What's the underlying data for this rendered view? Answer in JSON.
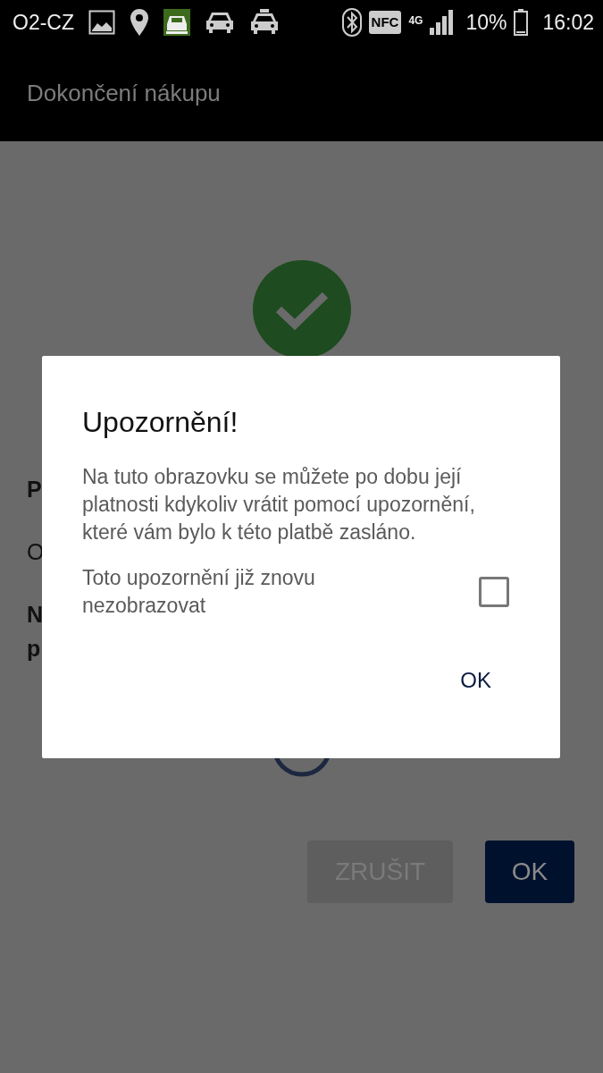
{
  "status_bar": {
    "carrier": "O2-CZ",
    "nfc": "NFC",
    "network": "4G",
    "battery": "10%",
    "time": "16:02"
  },
  "app_bar": {
    "title": "Dokončení nákupu"
  },
  "background": {
    "labels": [
      {
        "text": "P",
        "bold": true
      },
      {
        "text": "O",
        "bold": false
      },
      {
        "text": "N",
        "bold": true
      },
      {
        "text": "p",
        "bold": true
      }
    ],
    "buttons": [
      {
        "label": "ZRUŠIT",
        "disabled": true
      },
      {
        "label": "OK",
        "disabled": false
      }
    ]
  },
  "dialog": {
    "title": "Upozornění!",
    "message": "Na tuto obrazovku se můžete po dobu její platnosti kdykoliv vrátit pomocí upozornění, které vám bylo k této platbě zasláno.",
    "checkbox": {
      "label": "Toto upozornění již znovu nezobrazovat",
      "checked": false
    },
    "button": "OK"
  }
}
